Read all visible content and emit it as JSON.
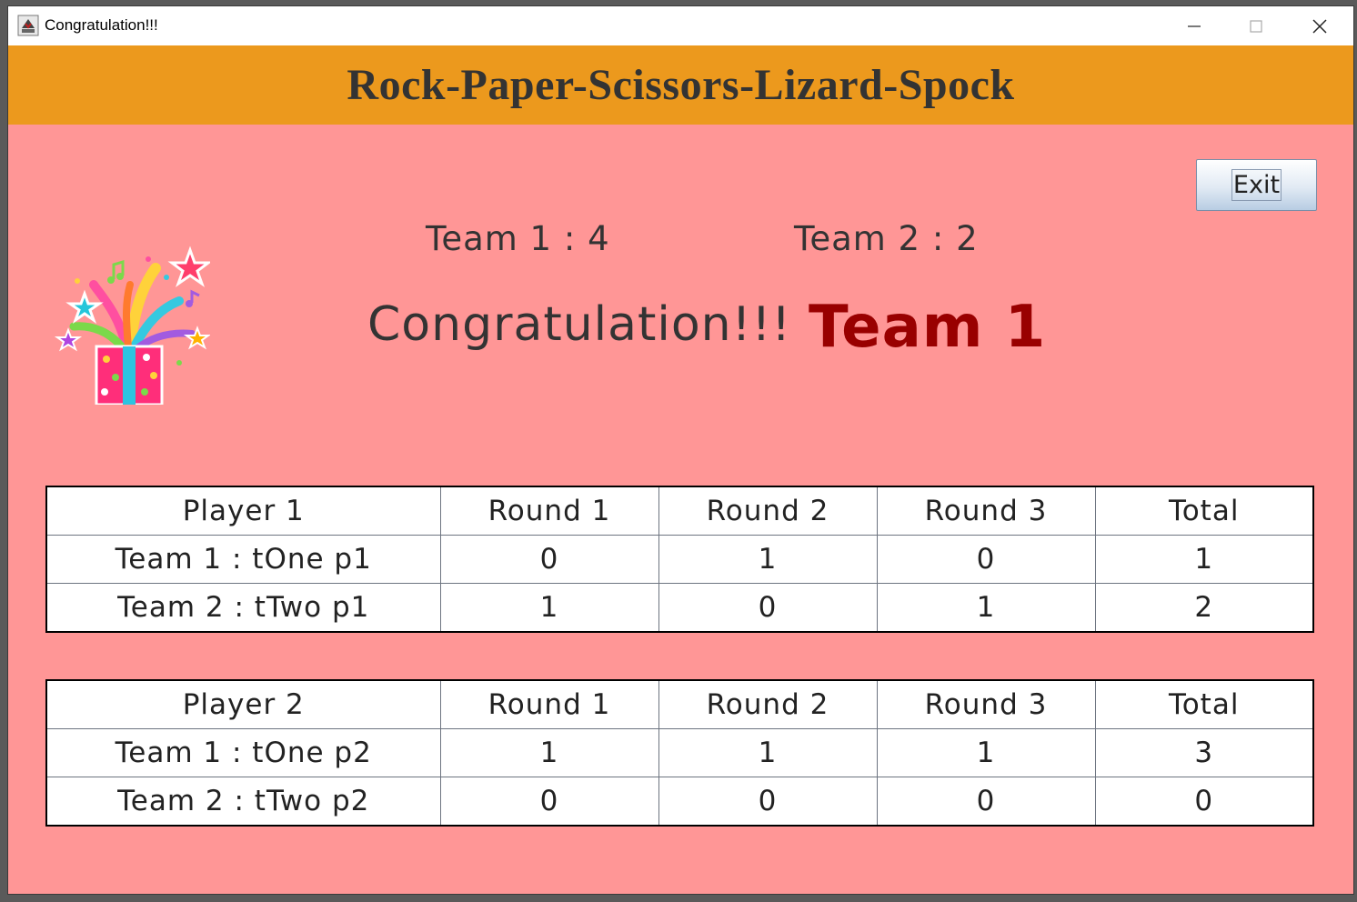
{
  "window": {
    "title": "Congratulation!!!"
  },
  "header": {
    "title": "Rock-Paper-Scissors-Lizard-Spock"
  },
  "exit_button": {
    "label": "Exit"
  },
  "scores": {
    "team1": "Team 1 : 4",
    "team2": "Team 2 : 2"
  },
  "congrats": {
    "text": "Congratulation!!!",
    "winner": "Team 1"
  },
  "tables": [
    {
      "headers": [
        "Player 1",
        "Round 1",
        "Round 2",
        "Round 3",
        "Total"
      ],
      "rows": [
        [
          "Team 1 : tOne p1",
          "0",
          "1",
          "0",
          "1"
        ],
        [
          "Team 2 : tTwo p1",
          "1",
          "0",
          "1",
          "2"
        ]
      ]
    },
    {
      "headers": [
        "Player 2",
        "Round 1",
        "Round 2",
        "Round 3",
        "Total"
      ],
      "rows": [
        [
          "Team 1 : tOne p2",
          "1",
          "1",
          "1",
          "3"
        ],
        [
          "Team 2 : tTwo p2",
          "0",
          "0",
          "0",
          "0"
        ]
      ]
    }
  ],
  "colors": {
    "background": "#ff9696",
    "header_band": "#ec991d",
    "winner_text": "#990000"
  },
  "icons": {
    "app": "java-cup-icon",
    "gift": "gift-box-confetti-icon"
  }
}
